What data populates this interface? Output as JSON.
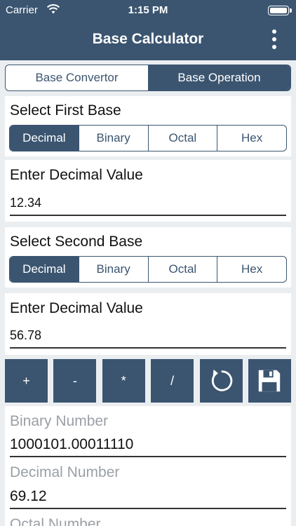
{
  "status": {
    "carrier": "Carrier",
    "time": "1:15 PM"
  },
  "nav": {
    "title": "Base Calculator"
  },
  "mode_tabs": [
    {
      "label": "Base Convertor",
      "active": false
    },
    {
      "label": "Base Operation",
      "active": true
    }
  ],
  "first": {
    "label": "Select First Base",
    "options": [
      "Decimal",
      "Binary",
      "Octal",
      "Hex"
    ],
    "selected": "Decimal",
    "input_label": "Enter Decimal Value",
    "input_value": "12.34"
  },
  "second": {
    "label": "Select Second Base",
    "options": [
      "Decimal",
      "Binary",
      "Octal",
      "Hex"
    ],
    "selected": "Decimal",
    "input_label": "Enter Decimal Value",
    "input_value": "56.78"
  },
  "operations": {
    "add": "+",
    "subtract": "-",
    "multiply": "*",
    "divide": "/"
  },
  "icons": {
    "reset": "refresh-icon",
    "save": "save-icon",
    "menu": "more-vertical-icon"
  },
  "results": [
    {
      "label": "Binary Number",
      "value": "1000101.00011110"
    },
    {
      "label": "Decimal Number",
      "value": "69.12"
    },
    {
      "label": "Octal Number",
      "value": ""
    }
  ],
  "colors": {
    "primary": "#3b5570",
    "background": "#ebeef1",
    "muted_label": "#9aa0a6"
  }
}
